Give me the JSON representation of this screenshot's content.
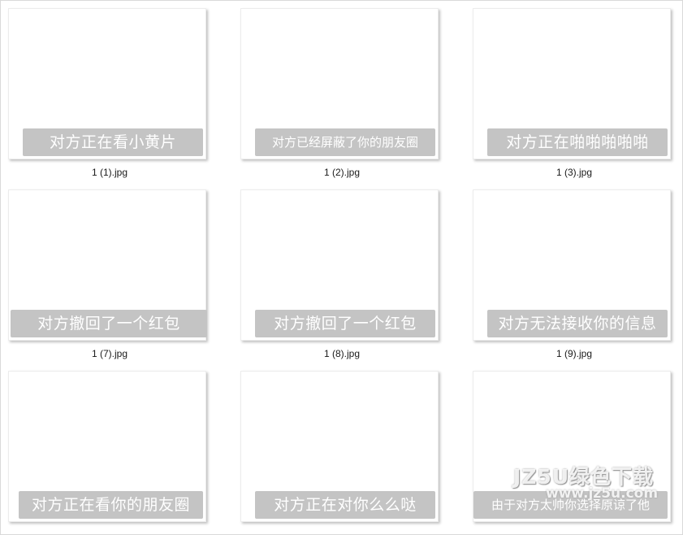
{
  "images": [
    {
      "caption": "对方正在看小黄片",
      "filename": "1 (1).jpg"
    },
    {
      "caption": "对方已经屏蔽了你的朋友圈",
      "filename": "1 (2).jpg"
    },
    {
      "caption": "对方正在啪啪啪啪啪",
      "filename": "1 (3).jpg"
    },
    {
      "caption": "对方撤回了一个红包",
      "filename": "1 (7).jpg"
    },
    {
      "caption": "对方撤回了一个红包",
      "filename": "1 (8).jpg"
    },
    {
      "caption": "对方无法接收你的信息",
      "filename": "1 (9).jpg"
    },
    {
      "caption": "对方正在看你的朋友圈",
      "filename": ""
    },
    {
      "caption": "对方正在对你么么哒",
      "filename": ""
    },
    {
      "caption": "由于对方太帅你选择原谅了他",
      "filename": ""
    }
  ],
  "watermark": {
    "main": "JZ5U绿色下载",
    "sub": "www.jz5u.com"
  }
}
